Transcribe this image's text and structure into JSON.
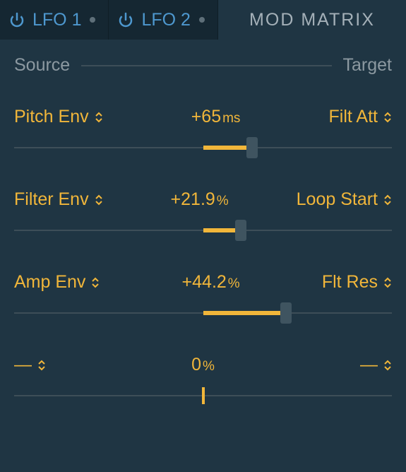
{
  "colors": {
    "accent": "#f1b63a",
    "link": "#4e98cf",
    "track": "#3d4e58",
    "bg": "#1f3543",
    "tabbar": "#152732"
  },
  "tabs": {
    "lfo1": {
      "label": "LFO 1",
      "powered": true,
      "active_dot": false
    },
    "lfo2": {
      "label": "LFO 2",
      "powered": true,
      "active_dot": false
    },
    "modmatrix": {
      "label": "MOD MATRIX",
      "selected": true
    }
  },
  "header": {
    "source": "Source",
    "target": "Target"
  },
  "slots": [
    {
      "source": "Pitch Env",
      "target": "Filt Att",
      "value_text": "+65",
      "unit": "ms",
      "fill_start_pct": 50,
      "fill_end_pct": 63,
      "thumb_pct": 63,
      "center_tick": false
    },
    {
      "source": "Filter Env",
      "target": "Loop Start",
      "value_text": "+21.9",
      "unit": "%",
      "fill_start_pct": 50,
      "fill_end_pct": 60,
      "thumb_pct": 60,
      "center_tick": false
    },
    {
      "source": "Amp Env",
      "target": "Flt Res",
      "value_text": "+44.2",
      "unit": "%",
      "fill_start_pct": 50,
      "fill_end_pct": 72,
      "thumb_pct": 72,
      "center_tick": false
    },
    {
      "source": "—",
      "target": "—",
      "value_text": "0",
      "unit": "%",
      "fill_start_pct": 50,
      "fill_end_pct": 50,
      "thumb_pct": 50,
      "center_tick": true
    }
  ]
}
